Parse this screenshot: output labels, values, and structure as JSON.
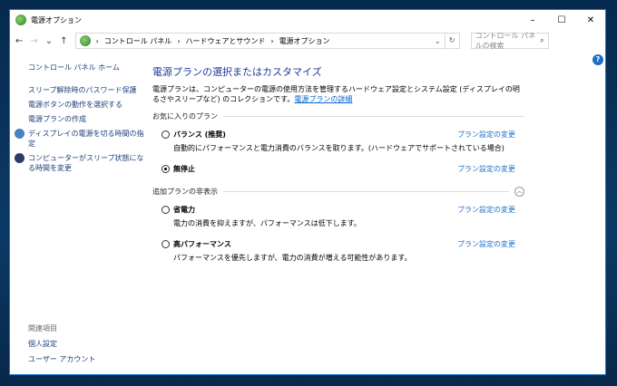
{
  "window": {
    "title": "電源オプション",
    "minimize": "–",
    "maximize": "☐",
    "close": "✕"
  },
  "address": {
    "back": "←",
    "forward": "→",
    "recent": "⌄",
    "up": "↑",
    "crumbs": [
      "コントロール パネル",
      "ハードウェアとサウンド",
      "電源オプション"
    ],
    "search_placeholder": "コントロール パネルの検索"
  },
  "sidebar": {
    "home": "コントロール パネル ホーム",
    "items": [
      "スリープ解除時のパスワード保護",
      "電源ボタンの動作を選択する",
      "電源プランの作成",
      "ディスプレイの電源を切る時間の指定",
      "コンピューターがスリープ状態になる時間を変更"
    ],
    "related_title": "関連項目",
    "related": [
      "個人設定",
      "ユーザー アカウント"
    ]
  },
  "main": {
    "title": "電源プランの選択またはカスタマイズ",
    "desc": "電源プランは、コンピューターの電源の使用方法を管理するハードウェア設定とシステム設定 (ディスプレイの明るさやスリープなど) のコレクションです。",
    "desc_link": "電源プランの詳細",
    "favorites_label": "お気に入りのプラン",
    "hidden_label": "追加プランの非表示",
    "change_link": "プラン設定の変更",
    "plans": [
      {
        "name": "バランス (推奨)",
        "desc": "自動的にパフォーマンスと電力消費のバランスを取ります。(ハードウェアでサポートされている場合)",
        "selected": false
      },
      {
        "name": "無停止",
        "desc": "",
        "selected": true
      },
      {
        "name": "省電力",
        "desc": "電力の消費を抑えますが、パフォーマンスは低下します。",
        "selected": false
      },
      {
        "name": "高パフォーマンス",
        "desc": "パフォーマンスを優先しますが、電力の消費が増える可能性があります。",
        "selected": false
      }
    ]
  },
  "help": "?"
}
